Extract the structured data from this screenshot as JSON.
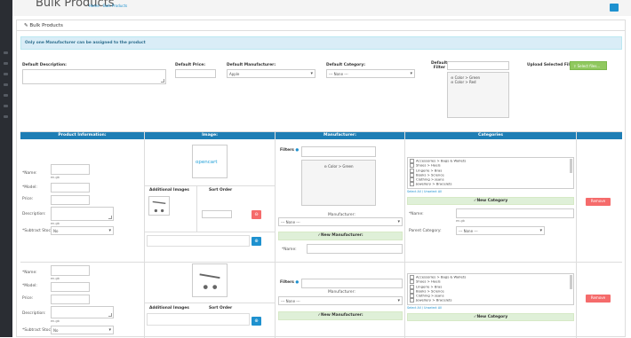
{
  "header": {
    "title": "Bulk Products",
    "breadcrumb_home": "Home",
    "breadcrumb_sep": "›",
    "breadcrumb_current": "Bulk Products"
  },
  "panel": {
    "title": "Bulk Products"
  },
  "alert": "Only one Manufacturer can be assigned to the product",
  "defaults": {
    "description_label": "Default Description:",
    "price_label": "Default Price:",
    "manufacturer_label": "Default Manufacturer:",
    "manufacturer_value": "Apple",
    "category_label": "Default Category:",
    "category_value": " --- None --- ",
    "filter_label": "Default Filter",
    "filter_options": [
      "Color > Green",
      "Color > Red"
    ],
    "upload_label": "Upload Selected Files:",
    "upload_button": "Select files..."
  },
  "table_headers": [
    "Product Information:",
    "Image:",
    "Manufacturer:",
    "Categories"
  ],
  "form_labels": {
    "name": "*Name:",
    "lang": "en-gb",
    "model": "*Model:",
    "price": "Price:",
    "description": "Description:",
    "subtract": "*Subtract Stock:",
    "subtract_value": "No",
    "filters": "Filters",
    "filter_opt": "Color > Green",
    "manufacturer": "Manufacturer:",
    "manu_value": " --- None --- ",
    "new_manufacturer": "New Manufacturer:",
    "new_name": "*Name:",
    "additional_images": "Additional Images",
    "sort_order": "Sort Order",
    "select_all": "Select All / Unselect All",
    "new_category": "New Category",
    "cat_name": "*Name:",
    "parent_category": "Parent Category:",
    "parent_value": " --- None --- ",
    "remove": "Remove"
  },
  "logo_text": "opencart",
  "categories": [
    "Accessories > Bags & Wallets",
    "Shoes > Heels",
    "Lingerie > Bras",
    "Books > Science",
    "Clothing > Jeans",
    "Jewellery > Bracelets"
  ],
  "colors": {
    "accent": "#1e7eb5",
    "green": "#90c85f",
    "red": "#f56b6b"
  }
}
